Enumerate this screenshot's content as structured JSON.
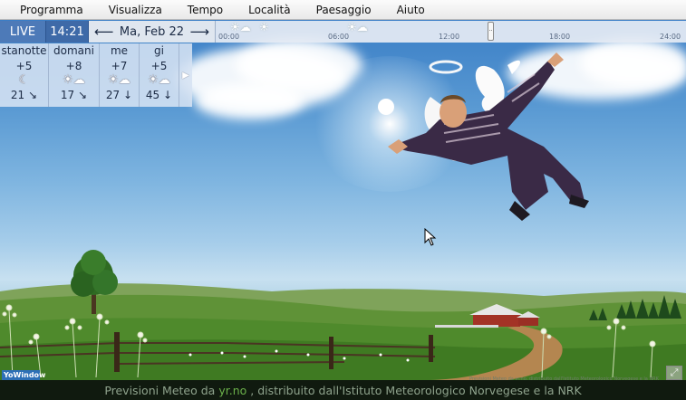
{
  "menu": [
    {
      "label": "Programma"
    },
    {
      "label": "Visualizza"
    },
    {
      "label": "Tempo"
    },
    {
      "label": "Località"
    },
    {
      "label": "Paesaggio"
    },
    {
      "label": "Aiuto"
    }
  ],
  "toolbar": {
    "live_label": "LIVE",
    "time": "14:21",
    "date": "Ma, Feb 22",
    "prev_icon": "arrow-left-icon",
    "next_icon": "arrow-right-icon"
  },
  "timeline": {
    "ticks": [
      "00:00",
      "06:00",
      "12:00",
      "18:00",
      "24:00"
    ]
  },
  "forecast": [
    {
      "name": "stanotte",
      "temp": "+5",
      "icon": "moon-icon",
      "wind": "21 ↘"
    },
    {
      "name": "domani",
      "temp": "+8",
      "icon": "sun-cloud-icon",
      "wind": "17 ↘"
    },
    {
      "name": "me",
      "temp": "+7",
      "icon": "sun-cloud-icon",
      "wind": "27 ↓"
    },
    {
      "name": "gi",
      "temp": "+5",
      "icon": "sun-cloud-icon",
      "wind": "45 ↓"
    }
  ],
  "footer": {
    "prefix": "Previsioni Meteo da",
    "link": "yr.no",
    "suffix": ", distribuito dall'Istituto Meteorologico Norvegese e la NRK",
    "brand": "YoWindow",
    "small_credit": "Previsioni Meteo da yr.no, distribuito dall'Istituto Meteorologico Norvegese e la NRK"
  },
  "colors": {
    "sky_top": "#3a7ec6",
    "grass": "#4f8a2c",
    "link": "#6bb04a"
  }
}
